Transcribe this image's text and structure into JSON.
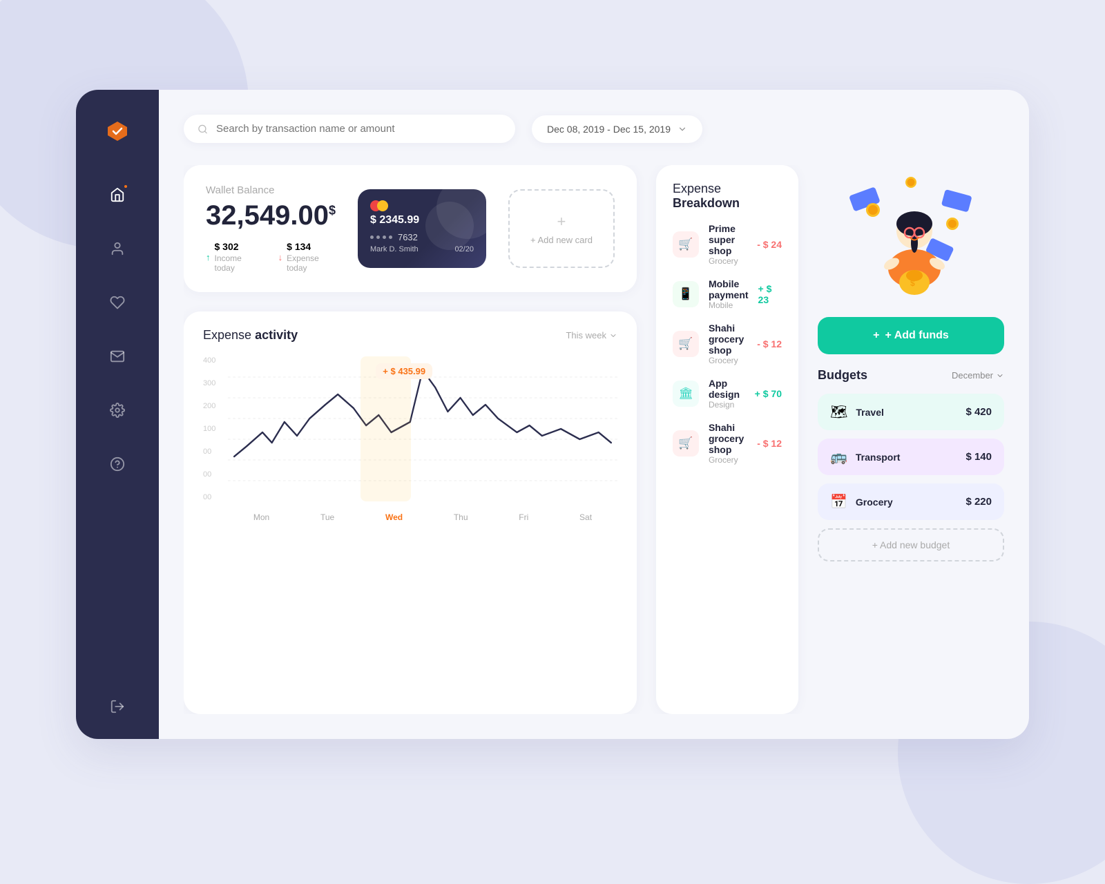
{
  "app": {
    "logo": "✳",
    "nav": [
      {
        "id": "home",
        "icon": "home",
        "active": true,
        "notif": true
      },
      {
        "id": "profile",
        "icon": "user",
        "active": false
      },
      {
        "id": "favorites",
        "icon": "heart",
        "active": false
      },
      {
        "id": "mail",
        "icon": "mail",
        "active": false
      },
      {
        "id": "settings",
        "icon": "gear",
        "active": false
      },
      {
        "id": "help",
        "icon": "question",
        "active": false
      }
    ],
    "logout_icon": "logout"
  },
  "topbar": {
    "search_placeholder": "Search by transaction name or amount",
    "date_range": "Dec 08, 2019 - Dec 15, 2019"
  },
  "wallet": {
    "label": "Wallet Balance",
    "balance": "32,549.00",
    "currency_sup": "$",
    "income_label": "Income today",
    "income_value": "$ 302",
    "expense_label": "Expense today",
    "expense_value": "$ 134"
  },
  "card": {
    "amount": "$ 2345.99",
    "dots": "• • • •",
    "number": "7632",
    "name": "Mark D. Smith",
    "expiry": "02/20"
  },
  "add_card_label": "+ Add new card",
  "chart": {
    "title_plain": "Expense",
    "title_bold": "activity",
    "period": "This week",
    "tooltip": "+ $ 435.99",
    "highlight_day": "Wed",
    "y_labels": [
      "400",
      "300",
      "200",
      "100",
      "00",
      "00",
      "00"
    ],
    "x_labels": [
      "Mon",
      "Tue",
      "Wed",
      "Thu",
      "Fri",
      "Sat"
    ]
  },
  "breakdown": {
    "title_plain": "Expense",
    "title_bold": "Breakdown",
    "items": [
      {
        "name": "Prime super shop",
        "category": "Grocery",
        "amount": "- $ 24",
        "type": "neg",
        "icon": "🛒",
        "color": "red"
      },
      {
        "name": "Mobile payment",
        "category": "Mobile",
        "amount": "+ $ 23",
        "type": "pos",
        "icon": "📱",
        "color": "green"
      },
      {
        "name": "Shahi grocery shop",
        "category": "Grocery",
        "amount": "- $ 12",
        "type": "neg",
        "icon": "🛒",
        "color": "red"
      },
      {
        "name": "App design",
        "category": "Design",
        "amount": "+ $ 70",
        "type": "pos",
        "icon": "🏛",
        "color": "teal"
      },
      {
        "name": "Shahi grocery shop",
        "category": "Grocery",
        "amount": "- $ 12",
        "type": "neg",
        "icon": "🛒",
        "color": "red"
      }
    ]
  },
  "add_funds_label": "+ Add funds",
  "budgets": {
    "title": "Budgets",
    "month": "December",
    "items": [
      {
        "name": "Travel",
        "amount": "$ 420",
        "icon": "🗺",
        "color": "travel"
      },
      {
        "name": "Transport",
        "amount": "$ 140",
        "icon": "🚌",
        "color": "transport"
      },
      {
        "name": "Grocery",
        "amount": "$ 220",
        "icon": "📅",
        "color": "grocery"
      }
    ],
    "add_label": "+ Add new budget"
  }
}
